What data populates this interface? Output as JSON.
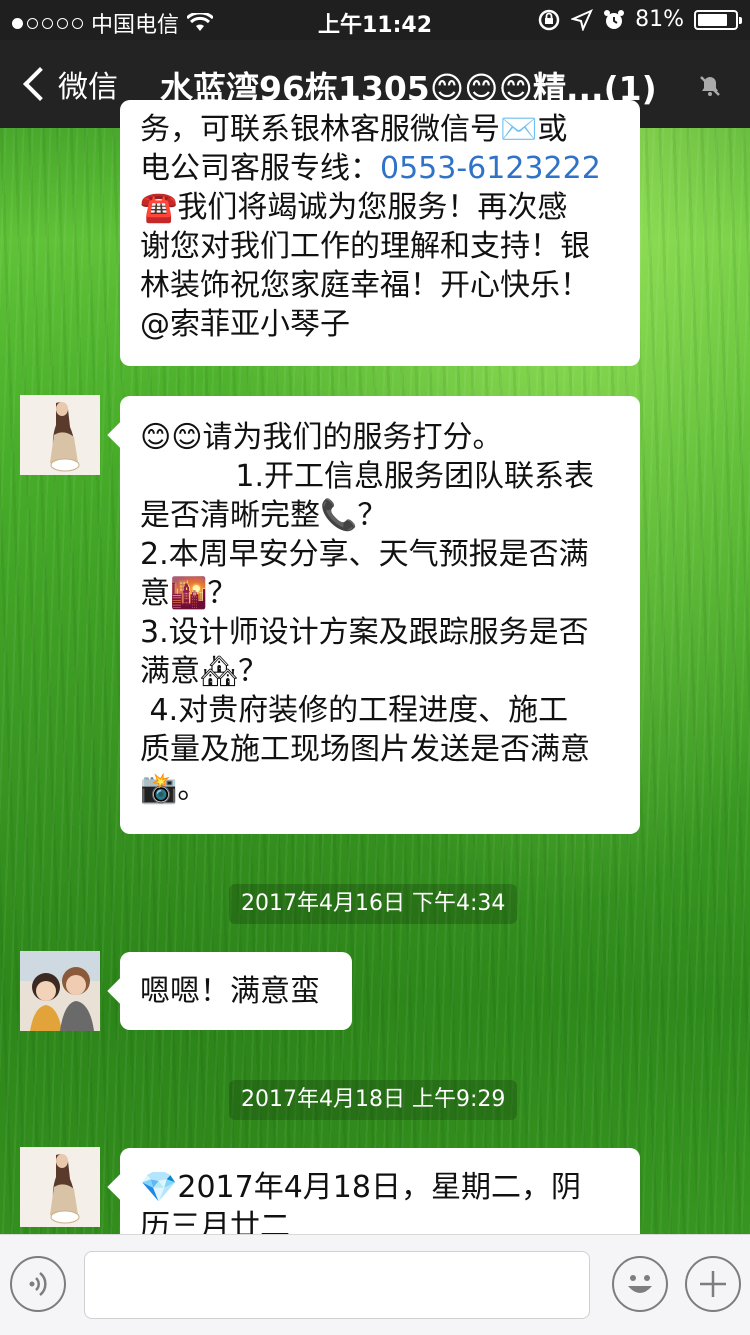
{
  "status_bar": {
    "carrier": "中国电信",
    "signal_bars": 1,
    "time": "上午11:42",
    "battery_percent": "81%",
    "battery_level": 0.81
  },
  "nav": {
    "back_label": "微信",
    "title": "水蓝湾96栋1305😊😊😊精...(1)"
  },
  "messages": {
    "m1": {
      "lines": [
        "务，可联系银林客服微信号✉️或",
        "电公司客服专线：",
        "☎️我们将竭诚为您服务！再次感",
        "谢您对我们工作的理解和支持！银",
        "林装饰祝您家庭幸福！开心快乐！",
        "@索菲亚小琴子"
      ],
      "phone": "0553-6123222"
    },
    "m2": {
      "lines": [
        "😊😊请为我们的服务打分。",
        "          1.开工信息服务团队联系表",
        "是否清晰完整📞？",
        "2.本周早安分享、天气预报是否满",
        "意🌇？",
        "3.设计师设计方案及跟踪服务是否",
        "满意🏘？",
        " 4.对贵府装修的工程进度、施工",
        "质量及施工现场图片发送是否满意",
        "📸。"
      ]
    },
    "ts1": "2017年4月16日 下午4:34",
    "m3": {
      "text": "嗯嗯！满意蛮"
    },
    "ts2": "2017年4月18日 上午9:29",
    "m4": {
      "lines": [
        "💎2017年4月18日，星期二，阴",
        "历三月廿二"
      ]
    }
  },
  "icons": {
    "voice": "voice-icon",
    "emoji": "emoji-icon",
    "plus": "plus-icon",
    "mute": "mute-icon",
    "wifi": "wifi-icon",
    "location": "location-icon",
    "alarm": "alarm-icon",
    "rotation_lock": "rotation-lock-icon"
  }
}
